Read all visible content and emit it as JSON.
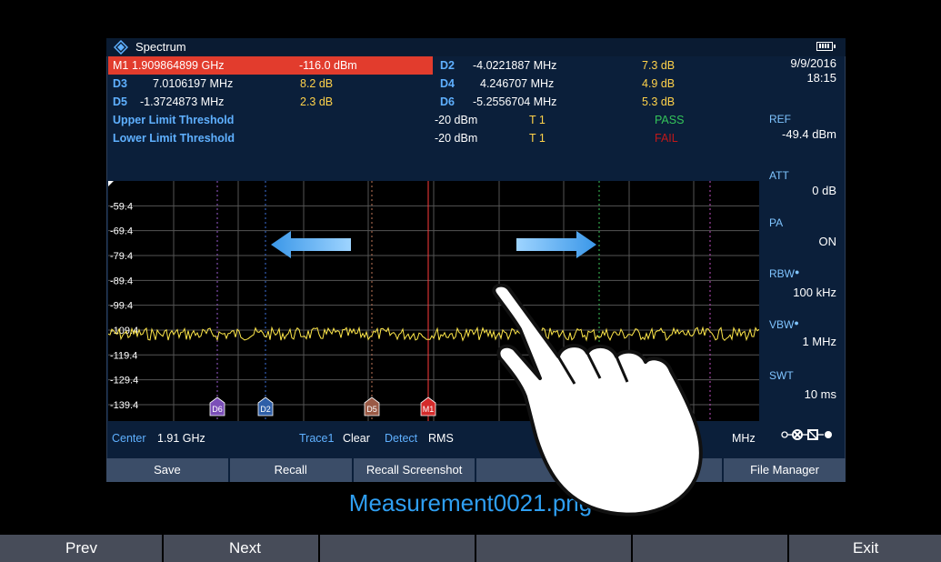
{
  "window": {
    "title": "Spectrum"
  },
  "markers": {
    "m1": {
      "label": "M1",
      "freq": "1.909864899 GHz",
      "level": "-116.0 dBm"
    },
    "d2": {
      "label": "D2",
      "freq": "-4.0221887 MHz",
      "level": "7.3 dB"
    },
    "d3": {
      "label": "D3",
      "freq": "7.0106197 MHz",
      "level": "8.2 dB"
    },
    "d4": {
      "label": "D4",
      "freq": "4.246707 MHz",
      "level": "4.9 dB"
    },
    "d5": {
      "label": "D5",
      "freq": "-1.3724873 MHz",
      "level": "2.3 dB"
    },
    "d6": {
      "label": "D6",
      "freq": "-5.2556704 MHz",
      "level": "5.3 dB"
    }
  },
  "limits": {
    "upper": {
      "label": "Upper Limit Threshold",
      "value": "-20 dBm",
      "trace": "T 1",
      "result": "PASS"
    },
    "lower": {
      "label": "Lower Limit Threshold",
      "value": "-20 dBm",
      "trace": "T 1",
      "result": "FAIL"
    }
  },
  "side": {
    "date": "9/9/2016",
    "time": "18:15",
    "ref_label": "REF",
    "ref_value": "-49.4 dBm",
    "att_label": "ATT",
    "att_value": "0 dB",
    "pa_label": "PA",
    "pa_value": "ON",
    "rbw_label": "RBW",
    "rbw_value": "100 kHz",
    "vbw_label": "VBW",
    "vbw_value": "1 MHz",
    "swt_label": "SWT",
    "swt_value": "10 ms"
  },
  "status": {
    "center_label": "Center",
    "center_value": "1.91 GHz",
    "trace_label": "Trace1",
    "trace_value": "Clear",
    "detect_label": "Detect",
    "detect_value": "RMS",
    "span_tail": "MHz"
  },
  "softkeys": [
    "Save",
    "Recall",
    "Recall Screenshot",
    "",
    "",
    "File Manager"
  ],
  "filename": "Measurement0021.png",
  "bottom_keys": [
    "Prev",
    "Next",
    "",
    "",
    "",
    "Exit"
  ],
  "icons": {
    "logo": "rohde-schwarz-logo",
    "battery": "battery-icon",
    "connector": "rf-connector-icon",
    "hand": "hand-pointer-icon"
  },
  "chart_data": {
    "type": "line",
    "y_ticks": [
      "-59.4",
      "-69.4",
      "-79.4",
      "-89.4",
      "-99.4",
      "-109.4",
      "-119.4",
      "-129.4",
      "-139.4"
    ],
    "ylim": [
      -146,
      -49.4
    ],
    "trace_level": -111,
    "marker_labels": [
      "D6",
      "D2",
      "D5",
      "M1"
    ],
    "colors": {
      "trace": "#ffe84a",
      "m1": "#ff3b3b",
      "grid": "#555",
      "plot_bg": "#000"
    }
  }
}
